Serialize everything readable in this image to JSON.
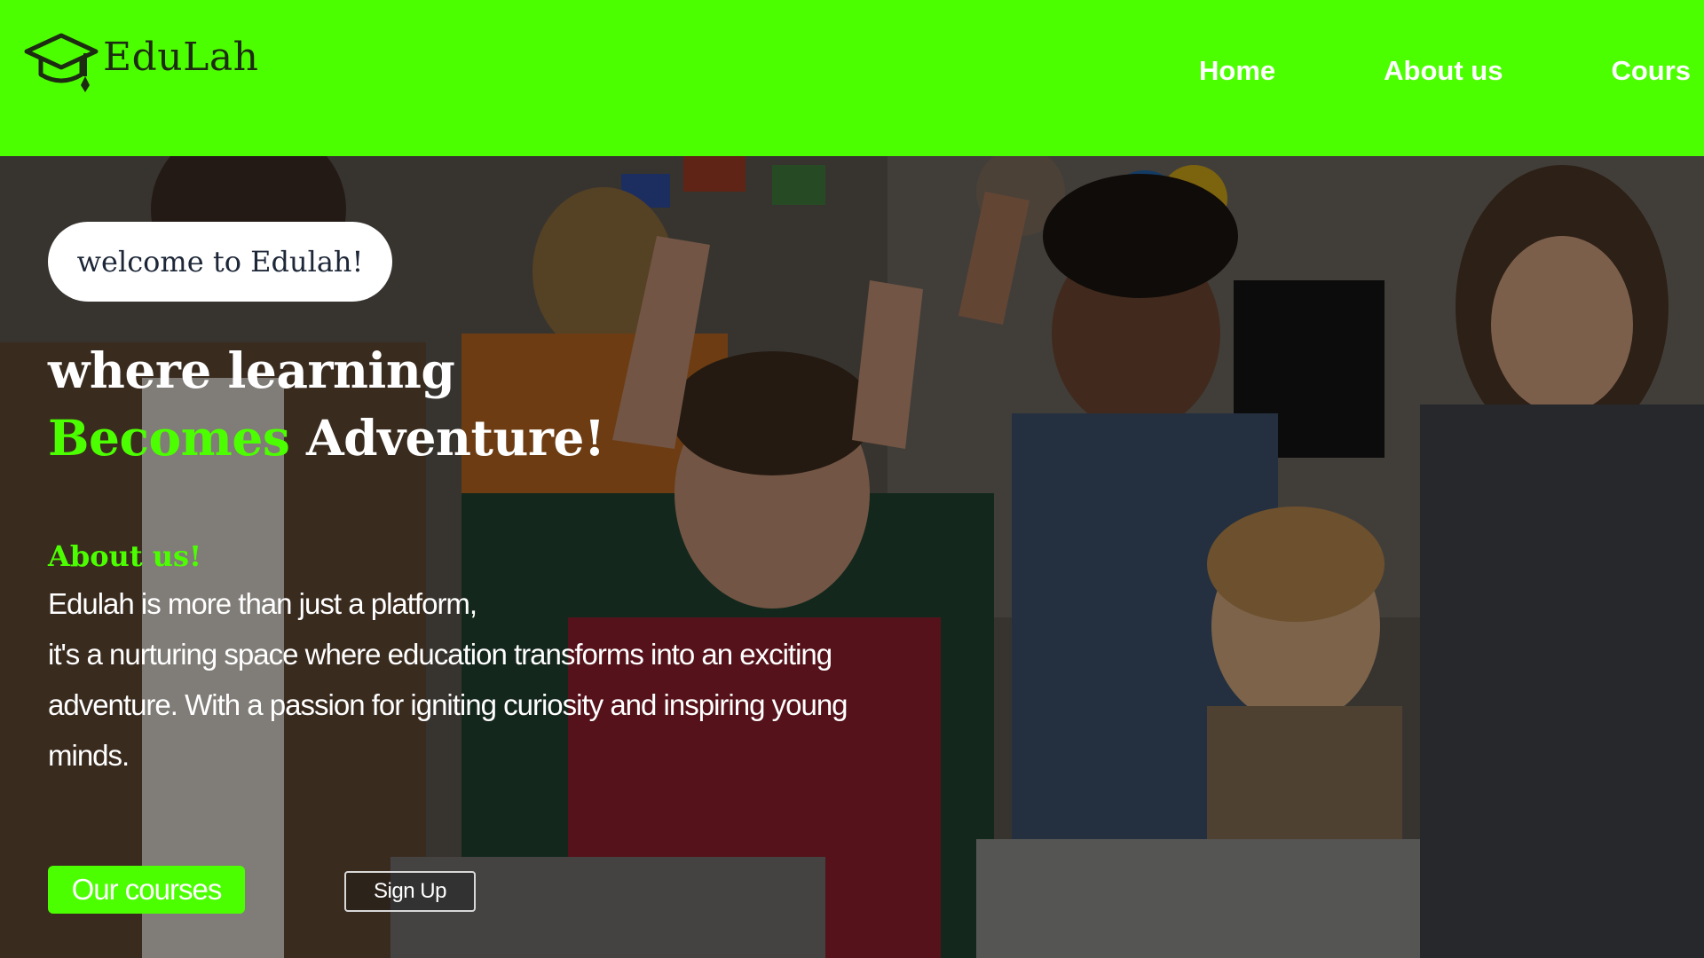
{
  "brand": {
    "name": "EduLah",
    "logo_icon": "graduation-cap-icon",
    "accent_color": "#4cff00"
  },
  "nav": {
    "items": [
      {
        "label": "Home"
      },
      {
        "label": "About us"
      },
      {
        "label": "Cours"
      }
    ]
  },
  "hero": {
    "welcome": "welcome to Edulah!",
    "headline_line1": "where learning",
    "headline_accent": "Becomes",
    "headline_rest": " Adventure!",
    "about_title": "About us!",
    "about_lines": [
      "Edulah is more than just a platform,",
      "it's a nurturing space where education transforms into an exciting",
      "adventure. With a passion for igniting curiosity and inspiring young",
      "minds."
    ],
    "primary_button": "Our courses",
    "secondary_button": "Sign Up"
  }
}
